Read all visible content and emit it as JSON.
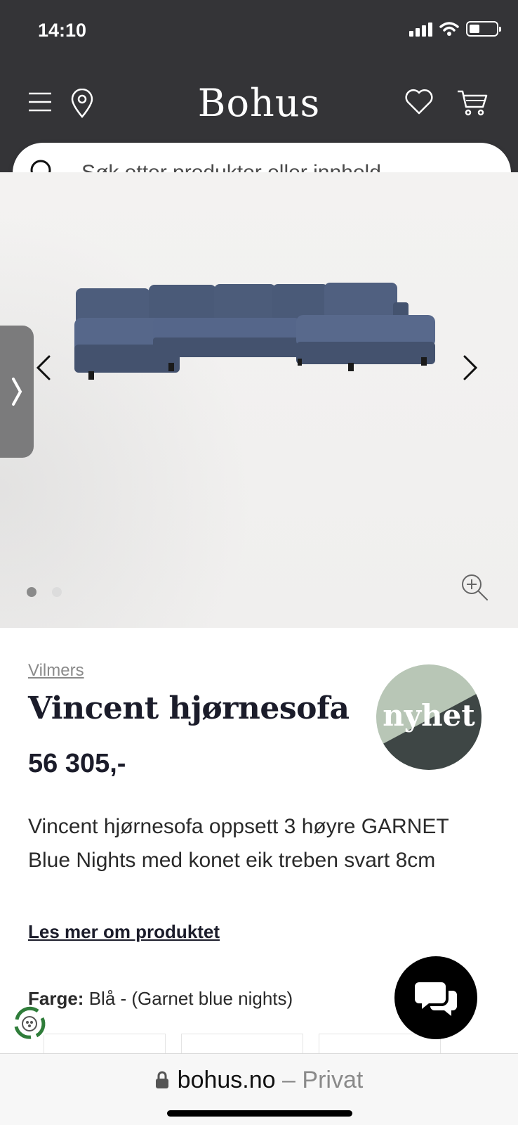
{
  "status_bar": {
    "time": "14:10"
  },
  "header": {
    "logo": "Bohus",
    "background_color": "#343437"
  },
  "search": {
    "placeholder": "Søk etter produkter eller innhold..."
  },
  "gallery": {
    "image_count": 2,
    "active_index": 0
  },
  "product": {
    "brand": "Vilmers",
    "title": "Vincent hjørnesofa",
    "price": "56 305,-",
    "badge": "nyhet",
    "description": "Vincent hjørnesofa oppsett 3 høyre GARNET Blue Nights med konet eik treben svart 8cm",
    "read_more": "Les mer om produktet",
    "color_label": "Farge:",
    "color_value": "Blå - (Garnet blue nights)"
  },
  "browser": {
    "domain": "bohus.no",
    "separator": " – ",
    "mode": "Privat"
  },
  "colors": {
    "badge_light": "#b7c4b3",
    "badge_dark": "#3d4443",
    "sofa": "#4a5a78",
    "chat": "#000000"
  }
}
